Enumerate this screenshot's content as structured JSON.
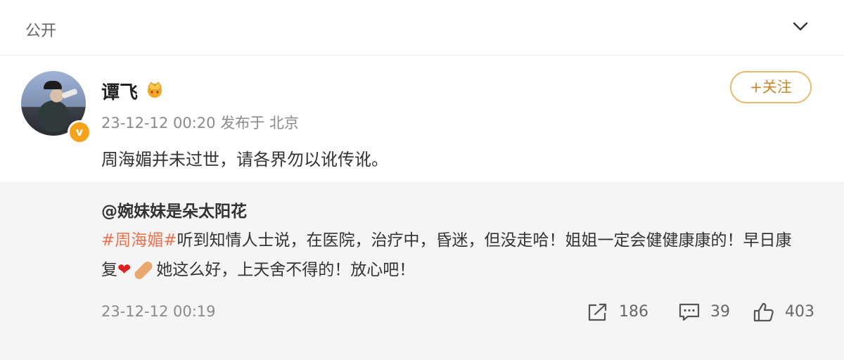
{
  "topbar": {
    "visibility_label": "公开",
    "expand_icon": "chevron-down-icon"
  },
  "post": {
    "username": "谭飞",
    "badge_icon": "crown-icon",
    "meta": "23-12-12 00:20 发布于 北京",
    "follow_label": "+关注",
    "text": "周海媚并未过世，请各界勿以讹传讹。"
  },
  "repost": {
    "original_user": "@婉妹妹是朵太阳花",
    "hashtag": "#周海媚#",
    "text_part1": "听到知情人士说，在医院，治疗中，昏迷，但没走哈！姐姐一定会健健康康的！早日康复",
    "heart_emoji": "❤",
    "text_part2": "她这么好，上天舍不得的！放心吧！",
    "time": "23-12-12 00:19",
    "actions": {
      "share_count": "186",
      "comment_count": "39",
      "like_count": "403"
    }
  },
  "colors": {
    "accent": "#eb7350",
    "follow_border": "#e9b96a",
    "verified_badge": "#f7a21b"
  }
}
